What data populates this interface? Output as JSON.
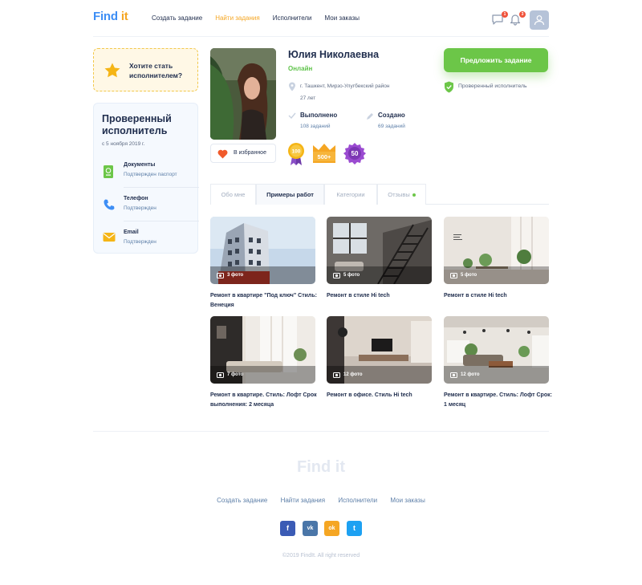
{
  "header": {
    "logo": {
      "part1": "Find",
      "part2": " it"
    },
    "nav": [
      {
        "label": "Создать задание",
        "active": false
      },
      {
        "label": "Найти задания",
        "active": true
      },
      {
        "label": "Исполнители",
        "active": false
      },
      {
        "label": "Мои заказы",
        "active": false
      }
    ],
    "messages_badge": "1",
    "notifications_badge": "3"
  },
  "promo": {
    "text": "Хотите стать исполнителем?"
  },
  "verified_card": {
    "title": "Проверенный исполнитель",
    "date": "с 5 ноября 2019 г.",
    "items": [
      {
        "icon": "passport-icon",
        "title": "Документы",
        "status": "Подтвержден паспорт"
      },
      {
        "icon": "phone-icon",
        "title": "Телефон",
        "status": "Подтвержден"
      },
      {
        "icon": "email-icon",
        "title": "Email",
        "status": "Подтвержден"
      }
    ]
  },
  "profile": {
    "name": "Юлия Николаевна",
    "status": "Онлайн",
    "location": "г. Ташкент, Мирзо-Улугбекский район",
    "age": "27 лет",
    "stats": [
      {
        "title": "Выполнено",
        "value": "108 заданий"
      },
      {
        "title": "Создано",
        "value": "69 заданий"
      }
    ],
    "favorite_label": "В избранное",
    "achievements": [
      "100",
      "500+",
      "50"
    ]
  },
  "actions": {
    "offer_label": "Предложить задание",
    "verified_label": "Проверенный исполнитель"
  },
  "tabs": [
    {
      "label": "Обо мне",
      "active": false
    },
    {
      "label": "Примеры работ",
      "active": true
    },
    {
      "label": "Категории",
      "active": false
    },
    {
      "label": "Отзывы",
      "active": false,
      "dot": true
    }
  ],
  "works": [
    {
      "photos": "3 фото",
      "caption": "Ремонт в квартире \"Под ключ\" Стиль: Венеция"
    },
    {
      "photos": "5 фото",
      "caption": "Ремонт в стиле Hi tech"
    },
    {
      "photos": "5 фото",
      "caption": "Ремонт в стиле Hi tech"
    },
    {
      "photos": "7 фото",
      "caption": "Ремонт в квартире. Стиль: Лофт Срок выполнения: 2 месяца"
    },
    {
      "photos": "12 фото",
      "caption": "Ремонт в офисе. Стиль Hi tech"
    },
    {
      "photos": "12 фото",
      "caption": "Ремонт в квартире. Стиль: Лофт Срок: 1 месяц"
    }
  ],
  "footer": {
    "logo": "Find it",
    "nav": [
      "Создать задание",
      "Найти задания",
      "Исполнители",
      "Мои заказы"
    ],
    "socials": [
      {
        "name": "facebook",
        "glyph": "f",
        "color": "#3b5bb5"
      },
      {
        "name": "vk",
        "glyph": "vk",
        "color": "#4a76a8"
      },
      {
        "name": "odnoklassniki",
        "glyph": "ok",
        "color": "#f5a623"
      },
      {
        "name": "twitter",
        "glyph": "t",
        "color": "#1da1f2"
      }
    ],
    "copyright": "©2019 FindIt. All right reserved"
  },
  "colors": {
    "accent_blue": "#3d8ef5",
    "accent_orange": "#f5a623",
    "accent_green": "#6cc648",
    "text_dark": "#1f2d4d"
  }
}
